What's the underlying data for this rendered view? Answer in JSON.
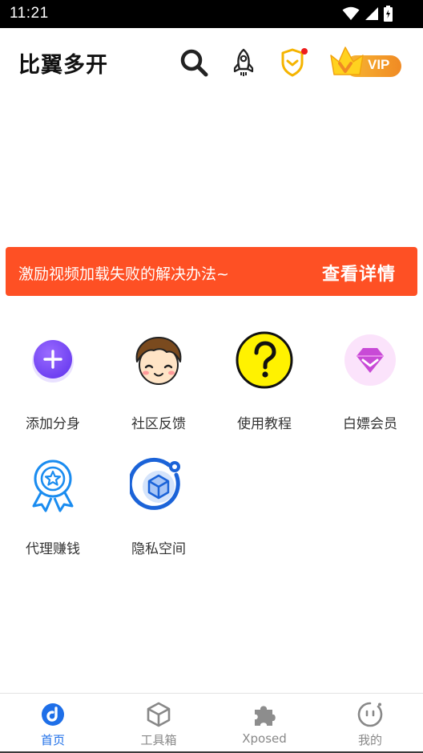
{
  "status_bar": {
    "time": "11:21"
  },
  "header": {
    "title": "比翼多开",
    "vip_label": "VIP"
  },
  "icons": {
    "search": "search-icon",
    "rocket": "rocket-icon",
    "shield": "shield-icon",
    "vip": "vip-crown-icon"
  },
  "notice": {
    "text": "激励视频加载失败的解决办法~",
    "action": "查看详情"
  },
  "grid": [
    {
      "label": "添加分身",
      "icon": "add-icon"
    },
    {
      "label": "社区反馈",
      "icon": "community-avatar-icon"
    },
    {
      "label": "使用教程",
      "icon": "question-icon"
    },
    {
      "label": "白嫖会员",
      "icon": "diamond-icon"
    },
    {
      "label": "代理赚钱",
      "icon": "award-ribbon-icon"
    },
    {
      "label": "隐私空间",
      "icon": "privacy-box-icon"
    }
  ],
  "bottom_nav": [
    {
      "label": "首页",
      "icon": "home-icon",
      "active": true
    },
    {
      "label": "工具箱",
      "icon": "toolbox-icon",
      "active": false
    },
    {
      "label": "Xposed",
      "icon": "puzzle-icon",
      "active": false
    },
    {
      "label": "我的",
      "icon": "profile-face-icon",
      "active": false
    }
  ],
  "colors": {
    "accent": "#1e6fe8",
    "banner": "#fe5024",
    "vip_gradient": [
      "#f7b733",
      "#f08a24"
    ],
    "add_purple": "#7b4dff",
    "question_yellow": "#fff200"
  }
}
